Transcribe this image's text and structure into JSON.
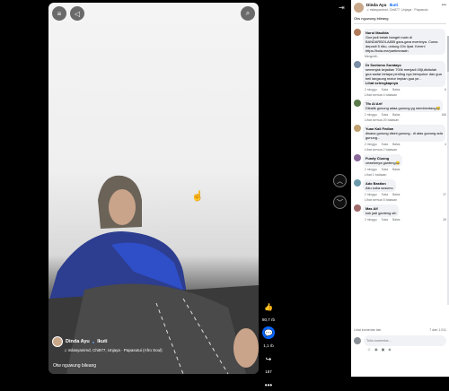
{
  "video": {
    "author": "Dinda Ayu",
    "verified": "●",
    "follow": "Ikuti",
    "audio": "♫ milasyanimd, Chi877, Unjaya · Papasutui (Afro Soul)",
    "caption": "Otw nguwung bileang",
    "likes": "80,7 rb",
    "comments": "1,1 rb",
    "shares": "187"
  },
  "panel": {
    "author": "Dinda Ayu",
    "follow": "Ikuti",
    "audio": "♫ milasyanimd, Chi877, Unjaya · Papasutu",
    "description": "Otw nguwung bileang",
    "comments": [
      {
        "name": "Nurul Maulida",
        "text": "Gue jadi betah banget main di BANDARBOLA855 gara-gara eventnya. Cuma deposit 5 ribu, untung 10x lipat. Keren! https://bola.me/partimeawin",
        "time": "Mengedit...",
        "reply": ""
      },
      {
        "name": "Dr Soetomo Suratayo",
        "text": "semenjak kejadian 700k menjadi 45jt,disitulah gua sadar betapa penting nya bersyukur dan gua beli langsung motor impian gua ye...",
        "more": "Lihat selengkapnya",
        "time": "2 minggu",
        "count": "6",
        "reply": "Lihat semua 4 balasan"
      },
      {
        "name": "Tfo Al Arif",
        "text": "Dibalik gunung adaa gunung yg membentang😂",
        "time": "2 minggu",
        "count": "166",
        "reply": "Lihat semua 20 balasan"
      },
      {
        "name": "Yuan Kali Fedian",
        "text": "disana gunung disini gunung.. di atas gunung ada gunung...",
        "time": "2 minggu",
        "count": "4",
        "reply": "Lihat semua 2 balasan"
      },
      {
        "name": "Fundy Cluong",
        "text": "cewekmya ganteng😂",
        "time": "2 minggu",
        "count": "",
        "reply": "Lihat 1 balasan"
      },
      {
        "name": "Ado Bastian",
        "text": "Aku suka susumu",
        "time": "2 minggu",
        "count": "27",
        "reply": "Lihat semua 5 balasan"
      },
      {
        "name": "Mas Alf",
        "text": "kok jadi ganteng sih",
        "time": "2 minggu",
        "count": "26",
        "reply": ""
      }
    ],
    "labels": {
      "suka": "Suka",
      "balas": "Balas"
    },
    "more_comments": "Lihat komentar lain",
    "counter": "7 dari 1.011",
    "compose_placeholder": "Tulis komentar..."
  }
}
